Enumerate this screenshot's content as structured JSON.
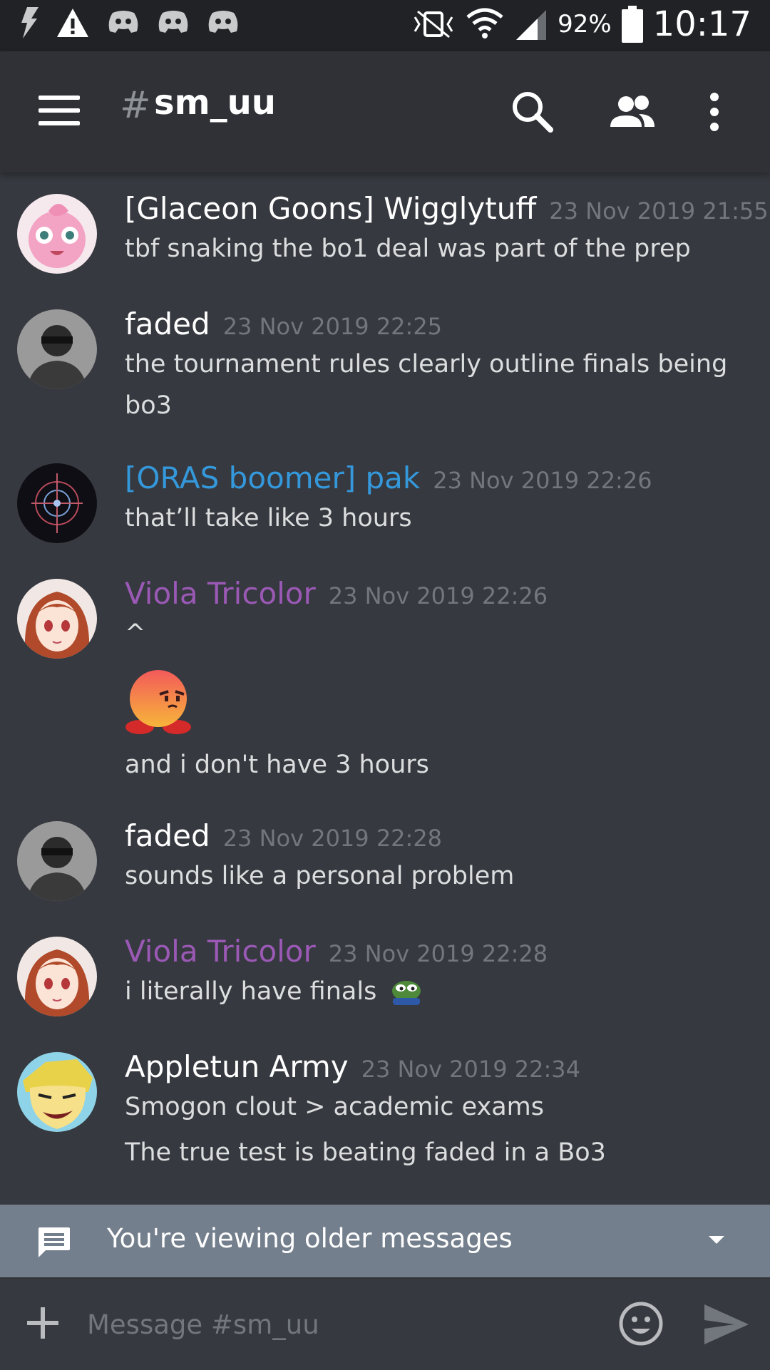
{
  "status_bar": {
    "battery": "92%",
    "time": "10:17"
  },
  "header": {
    "hash": "#",
    "channel": "sm_uu"
  },
  "messages": [
    {
      "author": "[Glaceon Goons] Wigglytuff",
      "color": "#ffffff",
      "time": "23 Nov 2019 21:55",
      "lines": [
        "tbf snaking the bo1 deal was part of the prep"
      ]
    },
    {
      "author": "faded",
      "color": "#ffffff",
      "time": "23 Nov 2019 22:25",
      "lines": [
        "the tournament rules clearly outline finals being bo3"
      ]
    },
    {
      "author": "[ORAS boomer] pak",
      "color": "#3498db",
      "time": "23 Nov 2019 22:26",
      "lines": [
        "that’ll take like 3 hours"
      ]
    },
    {
      "author": "Viola Tricolor",
      "color": "#9b59b6",
      "time": "23 Nov 2019 22:26",
      "lines": [
        "^",
        "and i don't have 3 hours"
      ]
    },
    {
      "author": "faded",
      "color": "#ffffff",
      "time": "23 Nov 2019 22:28",
      "lines": [
        "sounds like a personal problem"
      ]
    },
    {
      "author": "Viola Tricolor",
      "color": "#9b59b6",
      "time": "23 Nov 2019 22:28",
      "lines": [
        "i literally have finals"
      ]
    },
    {
      "author": "Appletun Army",
      "color": "#ffffff",
      "time": "23 Nov 2019 22:34",
      "lines": [
        "Smogon clout > academic exams",
        "The true test is beating faded in a Bo3"
      ]
    }
  ],
  "older_banner": {
    "text": "You're viewing older messages"
  },
  "composer": {
    "placeholder": "Message #sm_uu"
  },
  "colors": {
    "background": "#36393f",
    "header": "#2f3136",
    "banner": "#747f8d",
    "timestamp": "#72767d"
  },
  "icons": [
    "flash-icon",
    "warning-icon",
    "discord-notification-icon",
    "vibrate-icon",
    "wifi-icon",
    "signal-icon",
    "battery-icon",
    "menu-icon",
    "search-icon",
    "members-icon",
    "more-vert-icon",
    "chat-bubble-icon",
    "chevron-down-icon",
    "plus-icon",
    "emoji-icon",
    "send-icon"
  ]
}
